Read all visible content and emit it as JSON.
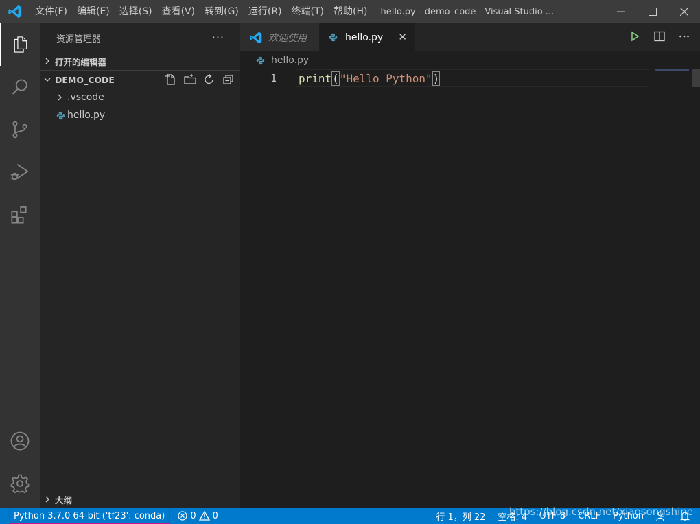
{
  "titlebar": {
    "menus": [
      "文件(F)",
      "编辑(E)",
      "选择(S)",
      "查看(V)",
      "转到(G)",
      "运行(R)",
      "终端(T)",
      "帮助(H)"
    ],
    "title": "hello.py - demo_code - Visual Studio ..."
  },
  "sidebar": {
    "title": "资源管理器",
    "more": "···",
    "open_editors": "打开的编辑器",
    "folder": "DEMO_CODE",
    "items": [
      {
        "label": ".vscode"
      },
      {
        "label": "hello.py"
      }
    ],
    "outline": "大纲"
  },
  "editor": {
    "tabs": [
      {
        "label": "欢迎使用"
      },
      {
        "label": "hello.py"
      }
    ],
    "tab_close": "✕",
    "breadcrumb": "hello.py",
    "line_number": "1",
    "code": {
      "fn": "print",
      "open": "(",
      "str": "\"Hello Python\"",
      "close": ")"
    }
  },
  "statusbar": {
    "interpreter": "Python 3.7.0 64-bit ('tf23': conda)",
    "errors": "0",
    "warnings": "0",
    "position": "行 1，列 22",
    "spaces": "空格: 4",
    "encoding": "UTF-8",
    "eol": "CRLF",
    "language": "Python"
  },
  "watermark": "https://blog.csdn.net/xiaosongshine",
  "colors": {
    "accent": "#007acc",
    "titlebar": "#3c3c3c",
    "activitybar": "#333333",
    "sidebar": "#252526",
    "editor": "#1e1e1e",
    "interpreter_border": "#c71585"
  }
}
